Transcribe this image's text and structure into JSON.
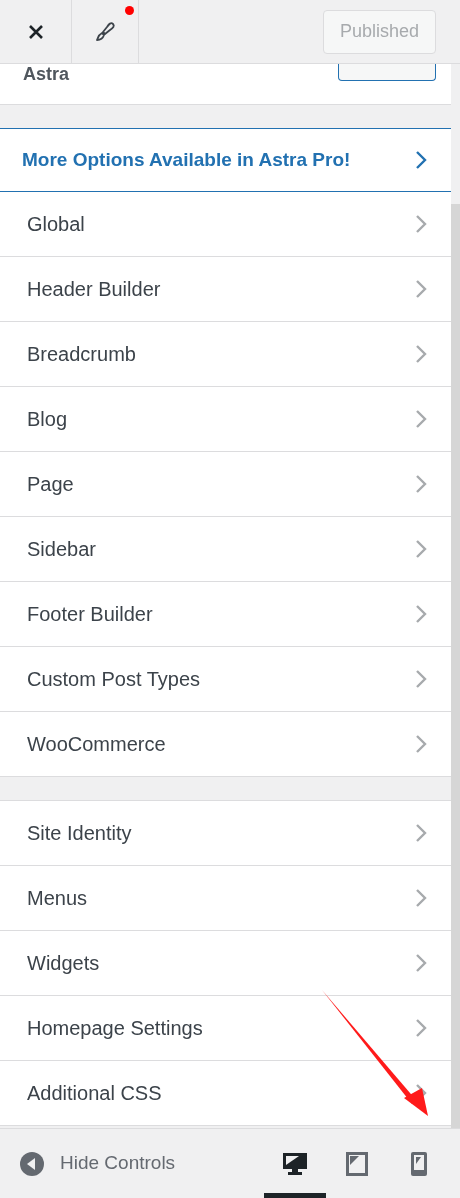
{
  "header": {
    "publish_button": "Published",
    "has_notification": true
  },
  "theme": {
    "name": "Astra"
  },
  "promo": {
    "label": "More Options Available in Astra Pro!"
  },
  "sections": [
    {
      "items": [
        {
          "label": "Global"
        },
        {
          "label": "Header Builder"
        },
        {
          "label": "Breadcrumb"
        },
        {
          "label": "Blog"
        },
        {
          "label": "Page"
        },
        {
          "label": "Sidebar"
        },
        {
          "label": "Footer Builder"
        },
        {
          "label": "Custom Post Types"
        },
        {
          "label": "WooCommerce"
        }
      ]
    },
    {
      "items": [
        {
          "label": "Site Identity"
        },
        {
          "label": "Menus"
        },
        {
          "label": "Widgets"
        },
        {
          "label": "Homepage Settings"
        },
        {
          "label": "Additional CSS"
        }
      ]
    }
  ],
  "footer": {
    "hide_controls": "Hide Controls",
    "devices": [
      {
        "kind": "desktop",
        "selected": true
      },
      {
        "kind": "tablet",
        "selected": false
      },
      {
        "kind": "mobile",
        "selected": false
      }
    ]
  }
}
